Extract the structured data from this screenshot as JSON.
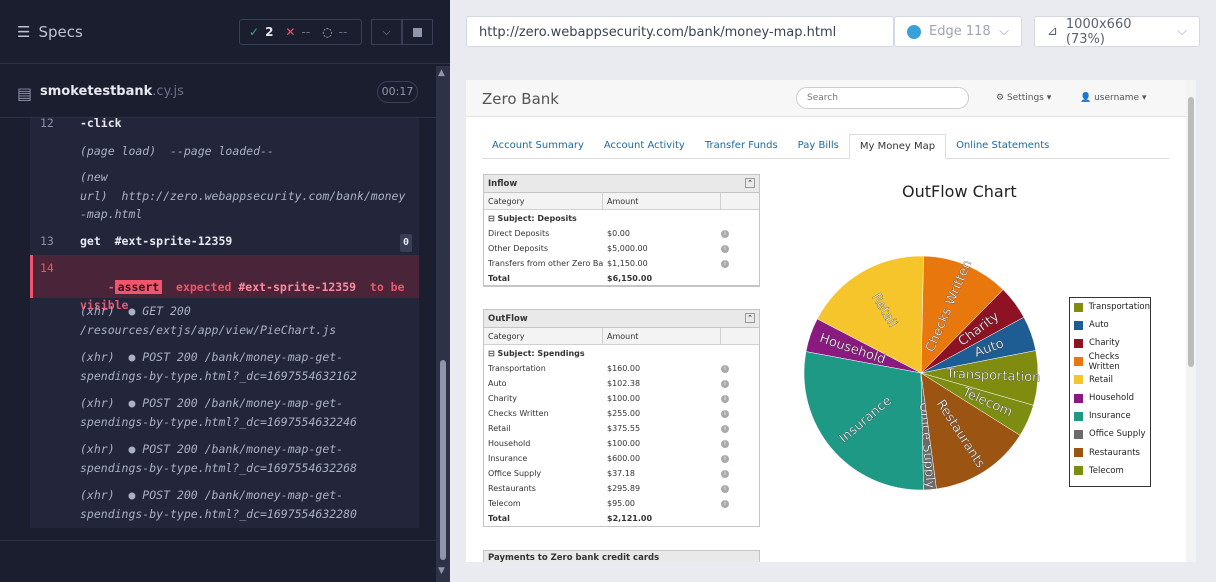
{
  "left": {
    "specs_label": "Specs",
    "passed": "2",
    "failed": "--",
    "pending": "--",
    "file_name": "smoketestbank",
    "file_ext": ".cy.js",
    "timer": "00:17",
    "commands": [
      {
        "num": "12",
        "text": "-click"
      },
      {
        "num": "",
        "text": "(page load)  --page loaded--"
      },
      {
        "num": "",
        "text": "(new\nurl)  http://zero.webappsecurity.com/bank/money\n-map.html"
      },
      {
        "num": "13",
        "text": "get  #ext-sprite-12359",
        "badge": "0"
      },
      {
        "num": "14",
        "text_a": "-",
        "assert": "assert",
        "text_b": "  expected ",
        "sel": "#ext-sprite-12359",
        "text_c": "  to be\nvisible"
      },
      {
        "num": "",
        "text": "(xhr)  ● GET 200\n/resources/extjs/app/view/PieChart.js"
      },
      {
        "num": "",
        "text": "(xhr)  ● POST 200 /bank/money-map-get-\nspendings-by-type.html?_dc=1697554632162"
      },
      {
        "num": "",
        "text": "(xhr)  ● POST 200 /bank/money-map-get-\nspendings-by-type.html?_dc=1697554632246"
      },
      {
        "num": "",
        "text": "(xhr)  ● POST 200 /bank/money-map-get-\nspendings-by-type.html?_dc=1697554632268"
      },
      {
        "num": "",
        "text": "(xhr)  ● POST 200 /bank/money-map-get-\nspendings-by-type.html?_dc=1697554632280"
      }
    ]
  },
  "top": {
    "url": "http://zero.webappsecurity.com/bank/money-map.html",
    "browser": "Edge 118",
    "viewport": "1000x660  (73%)"
  },
  "bank": {
    "brand": "Zero Bank",
    "search_placeholder": "Search",
    "settings": "Settings",
    "username": "username",
    "tabs": [
      "Account Summary",
      "Account Activity",
      "Transfer Funds",
      "Pay Bills",
      "My Money Map",
      "Online Statements"
    ],
    "inflow": {
      "title": "Inflow",
      "col1": "Category",
      "col2": "Amount",
      "subject": "Subject: Deposits",
      "rows": [
        [
          "Direct Deposits",
          "$0.00"
        ],
        [
          "Other Deposits",
          "$5,000.00"
        ],
        [
          "Transfers from other Zero Ba...",
          "$1,150.00"
        ]
      ],
      "total": [
        "Total",
        "$6,150.00"
      ]
    },
    "outflow": {
      "title": "OutFlow",
      "col1": "Category",
      "col2": "Amount",
      "subject": "Subject: Spendings",
      "rows": [
        [
          "Transportation",
          "$160.00"
        ],
        [
          "Auto",
          "$102.38"
        ],
        [
          "Charity",
          "$100.00"
        ],
        [
          "Checks Written",
          "$255.00"
        ],
        [
          "Retail",
          "$375.55"
        ],
        [
          "Household",
          "$100.00"
        ],
        [
          "Insurance",
          "$600.00"
        ],
        [
          "Office Supply",
          "$37.18"
        ],
        [
          "Restaurants",
          "$295.89"
        ],
        [
          "Telecom",
          "$95.00"
        ]
      ],
      "total": [
        "Total",
        "$2,121.00"
      ]
    },
    "payments_title": "Payments to Zero bank credit cards",
    "chart_title": "OutFlow Chart"
  },
  "chart_data": {
    "type": "pie",
    "title": "OutFlow Chart",
    "categories": [
      "Transportation",
      "Auto",
      "Charity",
      "Checks Written",
      "Retail",
      "Household",
      "Insurance",
      "Office Supply",
      "Restaurants",
      "Telecom"
    ],
    "values": [
      160.0,
      102.38,
      100.0,
      255.0,
      375.55,
      100.0,
      600.0,
      37.18,
      295.89,
      95.0
    ],
    "colors": [
      "#7f8c0f",
      "#1d5d94",
      "#8c1224",
      "#e8780e",
      "#f6c42b",
      "#8b1a80",
      "#1e9985",
      "#6b6b6b",
      "#9c5413",
      "#7c8d12"
    ],
    "legend_position": "right"
  }
}
